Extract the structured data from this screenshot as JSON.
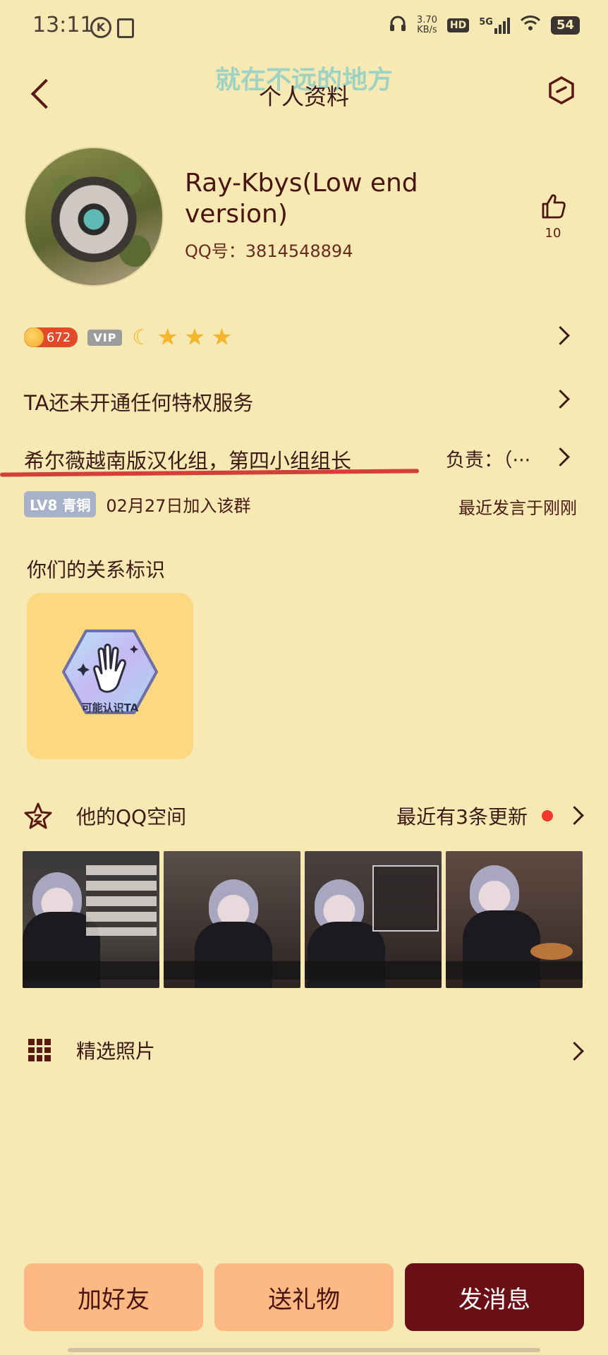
{
  "status_bar": {
    "time": "13:11",
    "k_icon": "K",
    "net_speed_top": "3.70",
    "net_speed_bottom": "KB/s",
    "hd": "HD",
    "network": "5G",
    "battery": "54"
  },
  "header": {
    "title": "个人资料",
    "watermark": "就在不远的地方"
  },
  "profile": {
    "nickname": "Ray-Kbys(Low end version)",
    "qq_label": "QQ号：3814548894",
    "like_count": "10"
  },
  "badges": {
    "coin_value": "672",
    "vip": "VIP",
    "moon": "☾",
    "stars": [
      "★",
      "★",
      "★"
    ]
  },
  "privilege_text": "TA还未开通任何特权服务",
  "group": {
    "title": "希尔薇越南版汉化组，第四小组组长",
    "responsibility": "负责：（···",
    "level": "LV8 青铜",
    "join_date": "02月27日加入该群",
    "last_speak": "最近发言于刚刚"
  },
  "relation": {
    "label": "你们的关系标识",
    "badge_name": "可能认识TA"
  },
  "qzone": {
    "label": "他的QQ空间",
    "update": "最近有3条更新"
  },
  "select_photos": {
    "label": "精选照片"
  },
  "actions": {
    "add_friend": "加好友",
    "send_gift": "送礼物",
    "send_message": "发消息"
  },
  "colors": {
    "background": "#f6e9b3",
    "primary_dark": "#6a0f16",
    "button_light": "#fdb984",
    "underline_red": "#d43f3a"
  }
}
